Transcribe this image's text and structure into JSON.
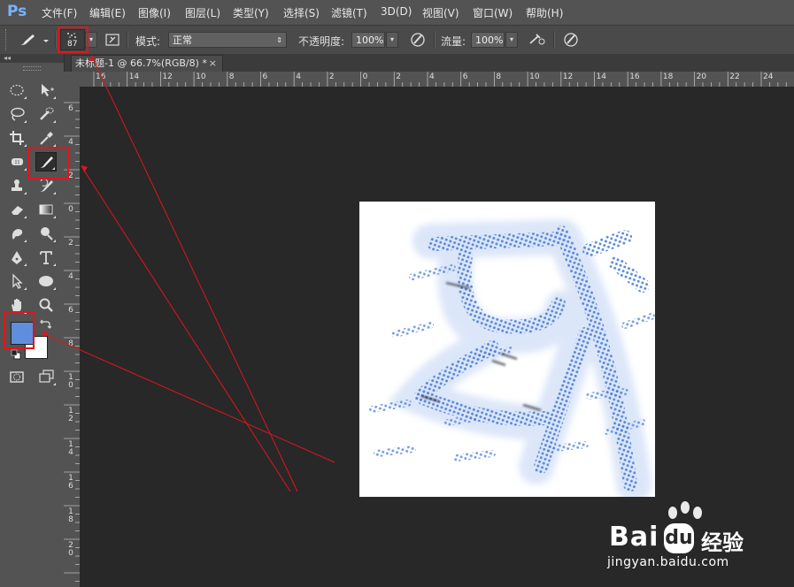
{
  "app": {
    "logo": "Ps"
  },
  "menu": [
    {
      "label": "文件(F)"
    },
    {
      "label": "编辑(E)"
    },
    {
      "label": "图像(I)"
    },
    {
      "label": "图层(L)"
    },
    {
      "label": "类型(Y)"
    },
    {
      "label": "选择(S)"
    },
    {
      "label": "滤镜(T)"
    },
    {
      "label": "3D(D)"
    },
    {
      "label": "视图(V)"
    },
    {
      "label": "窗口(W)"
    },
    {
      "label": "帮助(H)"
    }
  ],
  "options": {
    "brush_size": "87",
    "mode_label": "模式:",
    "mode_value": "正常",
    "opacity_label": "不透明度:",
    "opacity_value": "100%",
    "flow_label": "流量:",
    "flow_value": "100%"
  },
  "document_tab": {
    "title": "未标题-1 @ 66.7%(RGB/8) *",
    "close": "×"
  },
  "ruler": {
    "top_labels": [
      "16",
      "14",
      "12",
      "10",
      "8",
      "6",
      "4",
      "2",
      "0",
      "2",
      "4",
      "6",
      "8",
      "10",
      "12",
      "14",
      "16",
      "18",
      "20",
      "22",
      "24"
    ],
    "left_labels": [
      "6",
      "4",
      "2",
      "0",
      "2",
      "4",
      "6",
      "8",
      "10",
      "12",
      "14",
      "16",
      "18",
      "20"
    ]
  },
  "colors": {
    "foreground": "#5f8fdc",
    "background": "#ffffff",
    "brush_stroke": "#6a96e0",
    "annotation": "#e0151b"
  },
  "tools": [
    "elliptical-marquee",
    "move",
    "lasso",
    "quick-selection",
    "crop",
    "eyedropper",
    "spot-healing",
    "brush",
    "clone-stamp",
    "history-brush",
    "eraser",
    "gradient",
    "blur",
    "dodge",
    "pen",
    "type",
    "path-selection",
    "ellipse-shape",
    "hand",
    "zoom"
  ],
  "watermark": {
    "brand": "Bai",
    "brand2": "du",
    "cn": "经验",
    "url": "jingyan.baidu.com"
  }
}
